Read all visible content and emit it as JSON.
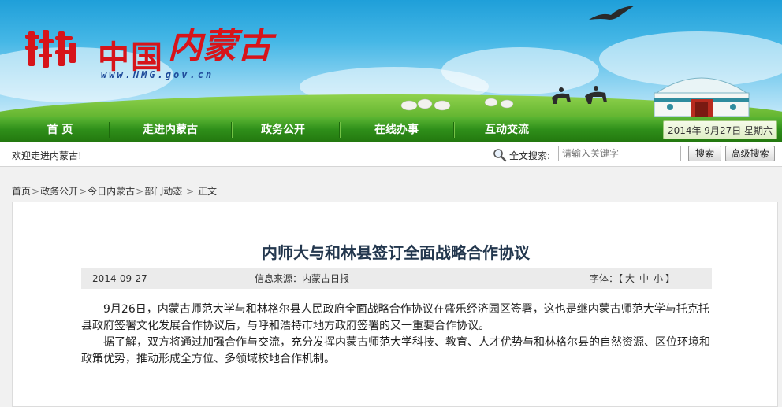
{
  "site": {
    "logo_text": "中国",
    "logo_calligraphy": "内蒙古",
    "url": "www.NMG.gov.cn"
  },
  "nav": {
    "items": [
      "首 页",
      "走进内蒙古",
      "政务公开",
      "在线办事",
      "互动交流"
    ],
    "date": "2014年 9月27日 星期六"
  },
  "welcome": "欢迎走进内蒙古!",
  "search": {
    "label": "全文搜索:",
    "placeholder": "请输入关键字",
    "search_button": "搜索",
    "advanced_button": "高级搜索"
  },
  "breadcrumb": [
    "首页",
    "政务公开",
    "今日内蒙古",
    "部门动态",
    "正文"
  ],
  "article": {
    "title": "内师大与和林县签订全面战略合作协议",
    "date": "2014-09-27",
    "source": "信息来源：内蒙古日报",
    "font_label": "字体：【",
    "font_sizes": [
      "大",
      "中",
      "小"
    ],
    "font_end": "】",
    "paragraphs": [
      "9月26日，内蒙古师范大学与和林格尔县人民政府全面战略合作协议在盛乐经济园区签署，这也是继内蒙古师范大学与托克托县政府签署文化发展合作协议后，与呼和浩特市地方政府签署的又一重要合作协议。",
      "据了解，双方将通过加强合作与交流，充分发挥内蒙古师范大学科技、教育、人才优势与和林格尔县的自然资源、区位环境和政策优势，推动形成全方位、多领域校地合作机制。"
    ]
  },
  "colors": {
    "nav_green": "#2f8f1a",
    "logo_red": "#d7141a",
    "title_blue": "#23374e"
  }
}
